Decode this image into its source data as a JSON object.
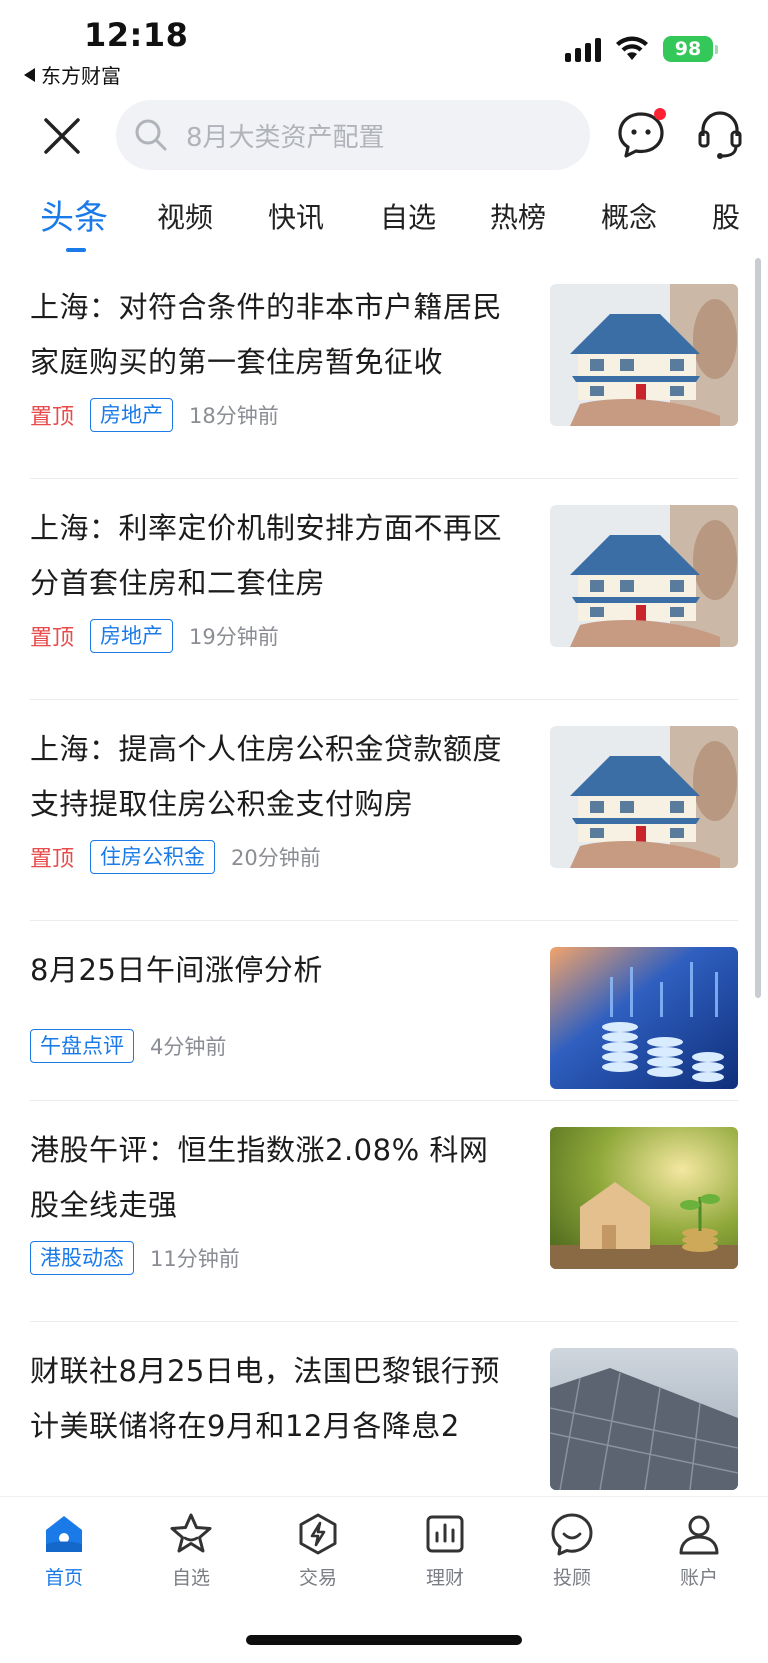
{
  "status_bar": {
    "time": "12:18",
    "back_app": "东方财富",
    "battery": "98",
    "icons": [
      "signal-icon",
      "wifi-icon",
      "battery-icon"
    ]
  },
  "header": {
    "close_icon": "close-icon",
    "search_placeholder": "8月大类资产配置",
    "message_icon": "chat-bubble-icon",
    "support_icon": "headset-icon"
  },
  "tabs": [
    {
      "label": "头条",
      "active": true
    },
    {
      "label": "视频"
    },
    {
      "label": "快讯"
    },
    {
      "label": "自选"
    },
    {
      "label": "热榜"
    },
    {
      "label": "概念"
    },
    {
      "label": "股"
    }
  ],
  "news": [
    {
      "title": "上海：对符合条件的非本市户籍居民家庭购买的第一套住房暂免征收",
      "pinned": "置顶",
      "tag": "房地产",
      "time": "18分钟前",
      "thumb": "house-model"
    },
    {
      "title": "上海：利率定价机制安排方面不再区分首套住房和二套住房",
      "pinned": "置顶",
      "tag": "房地产",
      "time": "19分钟前",
      "thumb": "house-model"
    },
    {
      "title": "上海：提高个人住房公积金贷款额度 支持提取住房公积金支付购房",
      "pinned": "置顶",
      "tag": "住房公积金",
      "time": "20分钟前",
      "thumb": "house-model"
    },
    {
      "title": "8月25日午间涨停分析",
      "tag": "午盘点评",
      "time": "4分钟前",
      "thumb": "coins-chart"
    },
    {
      "title": "港股午评：恒生指数涨2.08% 科网股全线走强",
      "tag": "港股动态",
      "time": "11分钟前",
      "thumb": "wooden-house"
    },
    {
      "title": "财联社8月25日电，法国巴黎银行预计美联储将在9月和12月各降息2",
      "thumb": "solar-panel"
    }
  ],
  "bottom_nav": [
    {
      "label": "首页",
      "icon": "home-icon",
      "active": true
    },
    {
      "label": "自选",
      "icon": "star-icon"
    },
    {
      "label": "交易",
      "icon": "trade-icon"
    },
    {
      "label": "理财",
      "icon": "finance-icon"
    },
    {
      "label": "投顾",
      "icon": "advisor-icon"
    },
    {
      "label": "账户",
      "icon": "account-icon"
    }
  ],
  "colors": {
    "accent": "#1a7be8",
    "pinned": "#e84b4b",
    "battery": "#34c759"
  }
}
